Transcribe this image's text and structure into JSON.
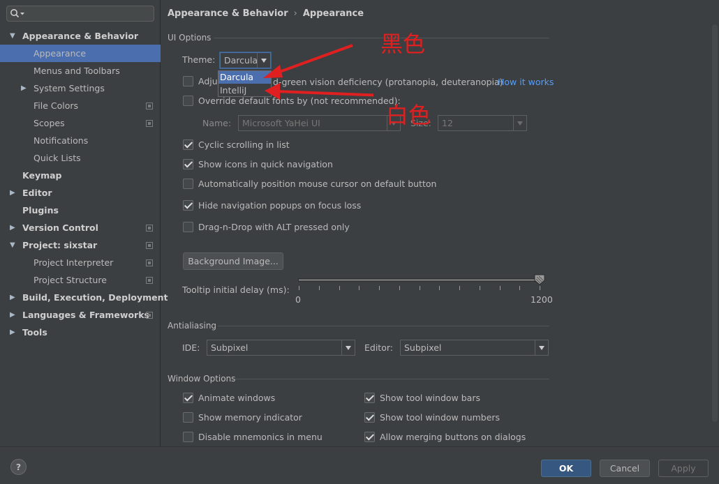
{
  "sidebar": {
    "search_placeholder": "",
    "items": [
      {
        "label": "Appearance & Behavior",
        "level": 0,
        "expanded": true,
        "bold": true
      },
      {
        "label": "Appearance",
        "level": 1,
        "selected": true
      },
      {
        "label": "Menus and Toolbars",
        "level": 1
      },
      {
        "label": "System Settings",
        "level": 1,
        "collapsed": true
      },
      {
        "label": "File Colors",
        "level": 1,
        "project_icon": true
      },
      {
        "label": "Scopes",
        "level": 1,
        "project_icon": true
      },
      {
        "label": "Notifications",
        "level": 1
      },
      {
        "label": "Quick Lists",
        "level": 1
      },
      {
        "label": "Keymap",
        "level": 0,
        "bold": true
      },
      {
        "label": "Editor",
        "level": 0,
        "collapsed": true,
        "bold": true
      },
      {
        "label": "Plugins",
        "level": 0,
        "bold": true
      },
      {
        "label": "Version Control",
        "level": 0,
        "collapsed": true,
        "bold": true,
        "project_icon": true
      },
      {
        "label": "Project: sixstar",
        "level": 0,
        "expanded": true,
        "bold": true,
        "project_icon": true
      },
      {
        "label": "Project Interpreter",
        "level": 1,
        "project_icon": true
      },
      {
        "label": "Project Structure",
        "level": 1,
        "project_icon": true
      },
      {
        "label": "Build, Execution, Deployment",
        "level": 0,
        "collapsed": true,
        "bold": true
      },
      {
        "label": "Languages & Frameworks",
        "level": 0,
        "collapsed": true,
        "bold": true,
        "project_icon": true
      },
      {
        "label": "Tools",
        "level": 0,
        "collapsed": true,
        "bold": true
      }
    ]
  },
  "breadcrumb": {
    "parent": "Appearance & Behavior",
    "separator": "›",
    "current": "Appearance"
  },
  "ui_options": {
    "title": "UI Options",
    "theme_label": "Theme:",
    "theme_value": "Darcula",
    "theme_options": [
      "Darcula",
      "IntelliJ"
    ],
    "adjust_prefix": "Adjus",
    "adjust_rest": "d-green vision deficiency (protanopia, deuteranopia)",
    "how_it_works": "How it works",
    "override_label": "Override default fonts by (not recommended):",
    "name_label": "Name:",
    "name_value": "Microsoft YaHei UI",
    "size_label": "Size:",
    "size_value": "12",
    "cyclic_scrolling": "Cyclic scrolling in list",
    "show_icons": "Show icons in quick navigation",
    "auto_position": "Automatically position mouse cursor on default button",
    "hide_popups": "Hide navigation popups on focus loss",
    "drag_n_drop": "Drag-n-Drop with ALT pressed only",
    "background_image": "Background Image...",
    "tooltip_label": "Tooltip initial delay (ms):",
    "slider_min": "0",
    "slider_max": "1200",
    "slider_value": 1200
  },
  "checkbox_states": {
    "adjust": false,
    "override": false,
    "cyclic_scrolling": true,
    "show_icons": true,
    "auto_position": false,
    "hide_popups": true,
    "drag_n_drop": false,
    "animate_windows": true,
    "show_memory": false,
    "disable_mnemonics": false,
    "show_tool_window_bars": true,
    "show_tool_window_numbers": true,
    "allow_merging": true
  },
  "antialiasing": {
    "title": "Antialiasing",
    "ide_label": "IDE:",
    "ide_value": "Subpixel",
    "editor_label": "Editor:",
    "editor_value": "Subpixel"
  },
  "window_options": {
    "title": "Window Options",
    "animate_windows": "Animate windows",
    "show_memory": "Show memory indicator",
    "disable_mnemonics": "Disable mnemonics in menu",
    "show_tool_window_bars": "Show tool window bars",
    "show_tool_window_numbers": "Show tool window numbers",
    "allow_merging": "Allow merging buttons on dialogs"
  },
  "annotations": {
    "black": "黑色",
    "white": "白色",
    "color": "#e02020"
  },
  "footer": {
    "help": "?",
    "ok": "OK",
    "cancel": "Cancel",
    "apply": "Apply"
  }
}
